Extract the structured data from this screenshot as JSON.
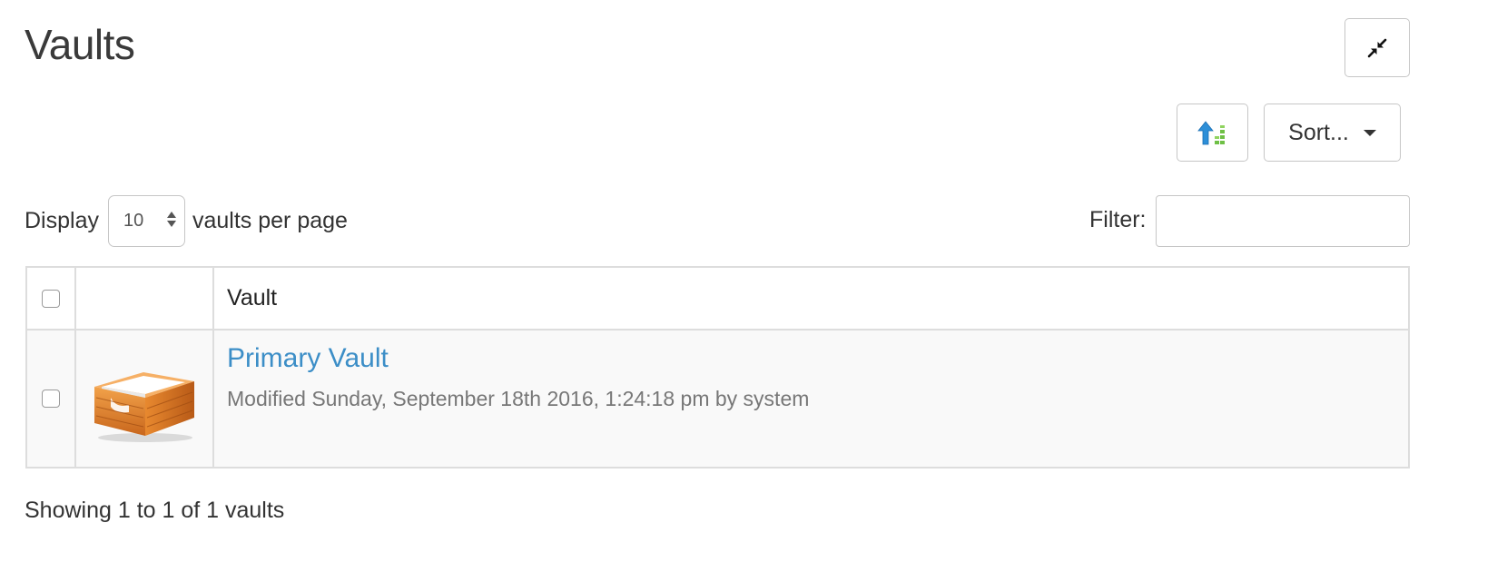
{
  "header": {
    "title": "Vaults",
    "collapse_icon": "compress-arrows-icon"
  },
  "toolbar": {
    "order_icon": "sort-order-arrow-icon",
    "sort_label": "Sort..."
  },
  "controls": {
    "display_label": "Display",
    "per_page_value": "10",
    "per_page_suffix": "vaults per page",
    "filter_label": "Filter:",
    "filter_value": ""
  },
  "table": {
    "columns": [
      "",
      "",
      "Vault"
    ],
    "rows": [
      {
        "icon": "vault-box-icon",
        "name": "Primary Vault",
        "meta": "Modified Sunday, September 18th 2016, 1:24:18 pm by system",
        "checked": false
      }
    ]
  },
  "footer": {
    "info": "Showing 1 to 1 of 1 vaults"
  },
  "colors": {
    "link": "#3c8ec7",
    "border": "#dddddd",
    "row_bg": "#f9f9f9"
  }
}
